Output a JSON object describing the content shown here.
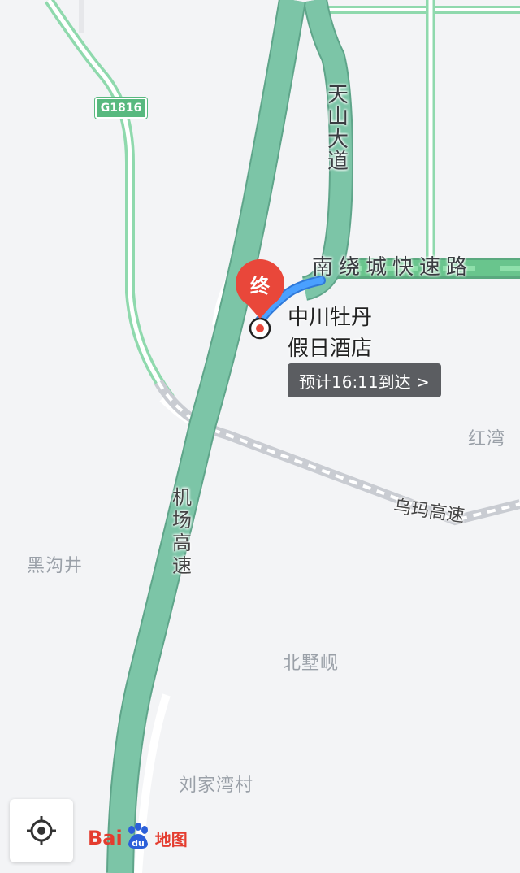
{
  "map": {
    "colors": {
      "background": "#f3f4f6",
      "highway": "#7cc5a7",
      "highway_edge": "#5fa58a",
      "green_road": "#8fd9ad",
      "route": "#3d8ef0",
      "rail": "#c9ccd2",
      "marker": "#e9473a"
    },
    "road_labels": {
      "tianshan": "天山大道",
      "nanrao": "南绕城快速路",
      "jichang": "机场高速",
      "wuma": "乌玛高速"
    },
    "shield": "G1816",
    "places": {
      "hongwan": "红湾",
      "heigoujing": "黑沟井",
      "beiwan": "北墅岘",
      "liujiawan": "刘家湾村"
    }
  },
  "destination": {
    "marker_text": "终",
    "name_line1": "中川牡丹",
    "name_line2": "假日酒店",
    "eta": "预计16:11到达 >"
  },
  "controls": {
    "locate_icon": "locate-icon"
  },
  "logo": {
    "bai": "Bai",
    "du": "du",
    "ditu": "地图"
  }
}
